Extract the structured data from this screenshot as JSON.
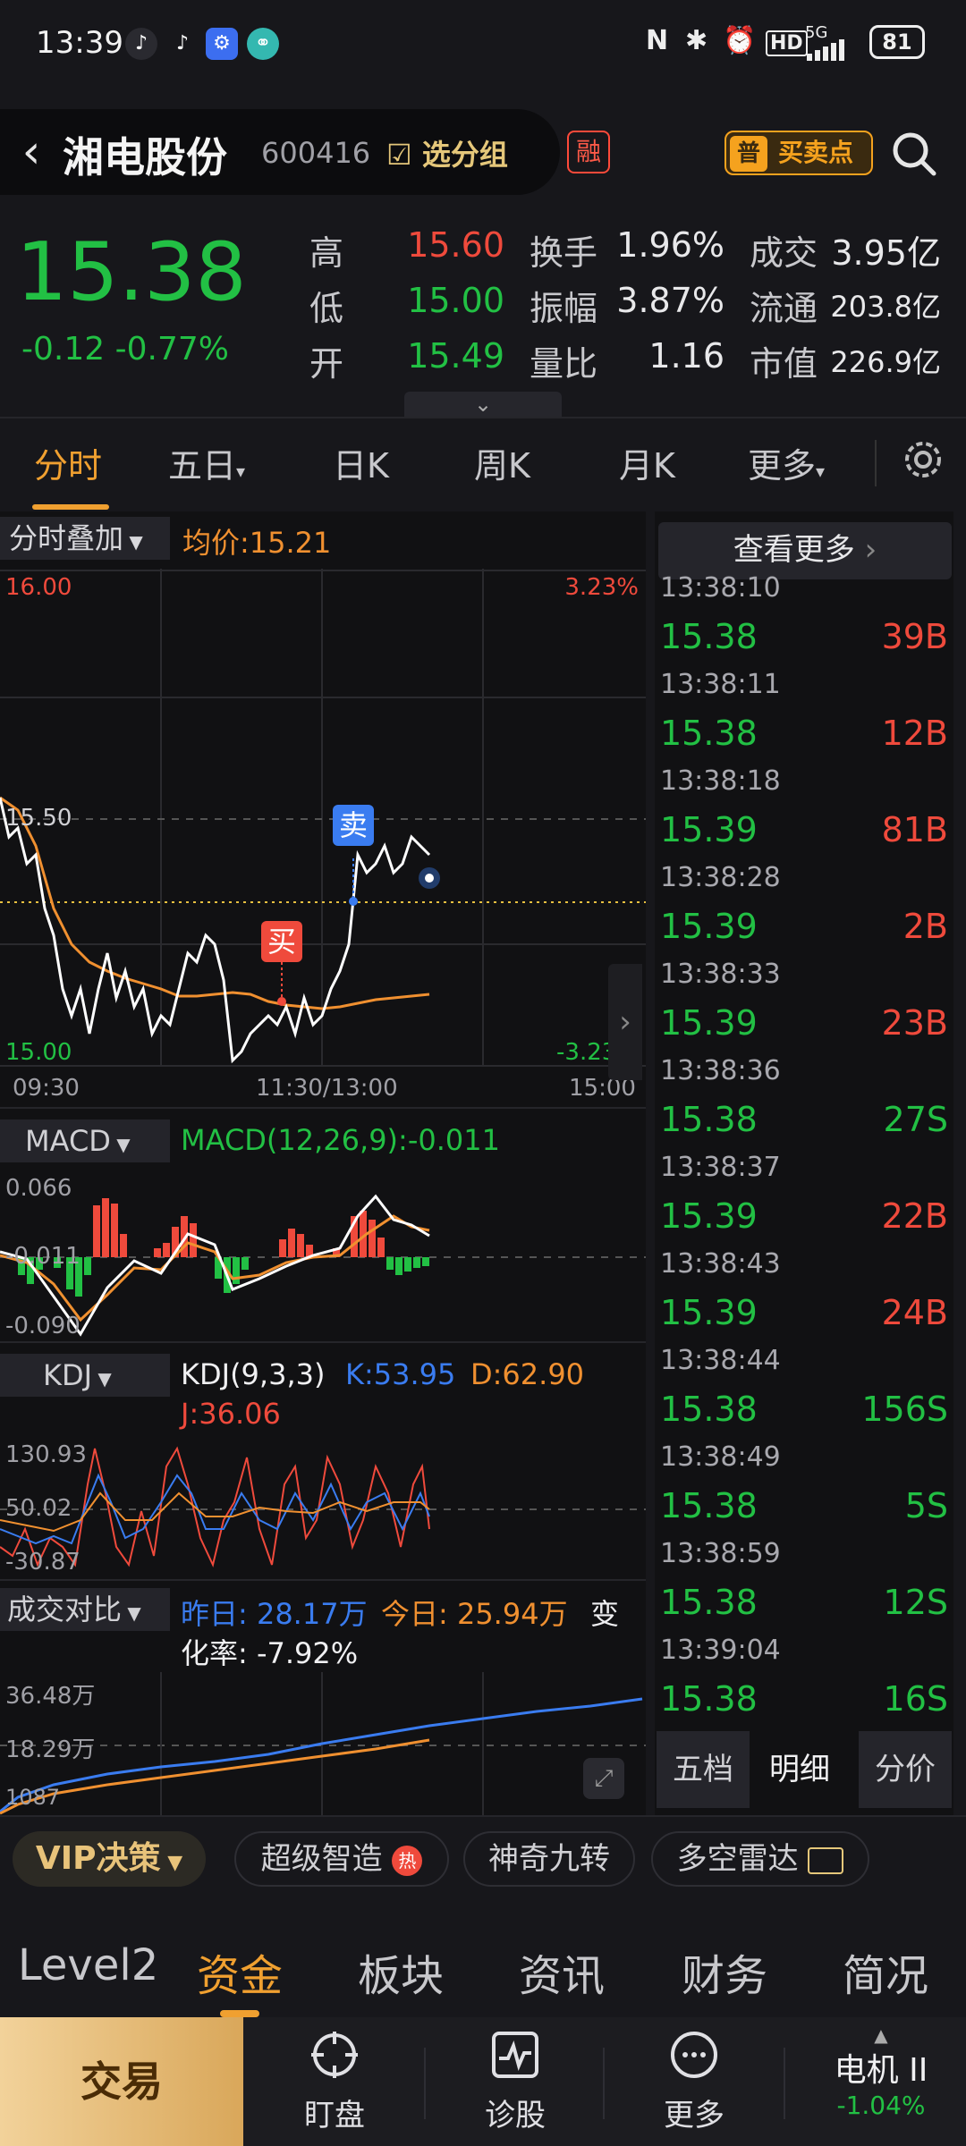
{
  "status_bar": {
    "time": "13:39",
    "battery": "81",
    "network": "5G"
  },
  "header": {
    "name": "湘电股份",
    "code": "600416",
    "select_group": "选分组",
    "rong": "融",
    "pu": "普",
    "buysell": "买卖点"
  },
  "quote": {
    "price": "15.38",
    "change": "-0.12",
    "change_pct": "-0.77%",
    "high_label": "高",
    "high": "15.60",
    "low_label": "低",
    "low": "15.00",
    "open_label": "开",
    "open": "15.49",
    "turnover_label": "换手",
    "turnover": "1.96%",
    "amplitude_label": "振幅",
    "amplitude": "3.87%",
    "volratio_label": "量比",
    "volratio": "1.16",
    "amount_label": "成交",
    "amount": "3.95亿",
    "float_label": "流通",
    "float": "203.8亿",
    "mcap_label": "市值",
    "mcap": "226.9亿"
  },
  "tabs": [
    "分时",
    "五日",
    "日K",
    "周K",
    "月K",
    "更多"
  ],
  "intraday": {
    "overlay": "分时叠加",
    "avg": "均价:15.21",
    "y_top": "16.00",
    "y_mid": "15.50",
    "y_bottom": "15.00",
    "pct_top": "3.23%",
    "pct_bottom": "-3.23%",
    "x_start": "09:30",
    "x_mid": "11:30/13:00",
    "x_end": "15:00",
    "sell_marker": "卖",
    "buy_marker": "买"
  },
  "macd": {
    "label": "MACD",
    "params": "MACD(12,26,9):-0.011",
    "top": "0.066",
    "mid": "-0.011",
    "bottom": "-0.090"
  },
  "kdj": {
    "label": "KDJ",
    "params": "KDJ(9,3,3)",
    "k": "K:53.95",
    "d": "D:62.90",
    "j": "J:36.06",
    "top": "130.93",
    "mid": "50.02",
    "bottom": "-30.87"
  },
  "volcmp": {
    "label": "成交对比",
    "yesterday": "昨日: 28.17万",
    "today": "今日: 25.94万",
    "rate_a": "变",
    "rate_b": "化率: -7.92%",
    "top": "36.48万",
    "mid": "18.29万",
    "bottom": "1087"
  },
  "ticks_panel": {
    "more": "查看更多",
    "rows": [
      {
        "time": "13:38:10",
        "price": "15.38",
        "vol": "39B",
        "side": "B"
      },
      {
        "time": "13:38:11",
        "price": "15.38",
        "vol": "12B",
        "side": "B"
      },
      {
        "time": "13:38:18",
        "price": "15.39",
        "vol": "81B",
        "side": "B"
      },
      {
        "time": "13:38:28",
        "price": "15.39",
        "vol": "2B",
        "side": "B"
      },
      {
        "time": "13:38:33",
        "price": "15.39",
        "vol": "23B",
        "side": "B"
      },
      {
        "time": "13:38:36",
        "price": "15.38",
        "vol": "27S",
        "side": "S"
      },
      {
        "time": "13:38:37",
        "price": "15.39",
        "vol": "22B",
        "side": "B"
      },
      {
        "time": "13:38:43",
        "price": "15.39",
        "vol": "24B",
        "side": "B"
      },
      {
        "time": "13:38:44",
        "price": "15.38",
        "vol": "156S",
        "side": "S"
      },
      {
        "time": "13:38:49",
        "price": "15.38",
        "vol": "5S",
        "side": "S"
      },
      {
        "time": "13:38:59",
        "price": "15.38",
        "vol": "12S",
        "side": "S"
      },
      {
        "time": "13:39:04",
        "price": "15.38",
        "vol": "16S",
        "side": "S"
      }
    ],
    "tabs": [
      "五档",
      "明细",
      "分价"
    ]
  },
  "quick_bar": {
    "vip": "VIP决策",
    "items": [
      "超级智造",
      "神奇九转",
      "多空雷达"
    ],
    "hot": "热"
  },
  "bottom_tabs": [
    "Level2",
    "资金",
    "板块",
    "资讯",
    "财务",
    "简况"
  ],
  "bottom_nav": {
    "trade": "交易",
    "watch": "盯盘",
    "diagnose": "诊股",
    "more": "更多",
    "stock": "电机 II",
    "stock_change": "-1.04%"
  },
  "colors": {
    "up": "#ef4a3c",
    "down": "#22c044",
    "accent": "#f0a030",
    "avg_line": "#f09030",
    "blue": "#3a7cf0"
  }
}
